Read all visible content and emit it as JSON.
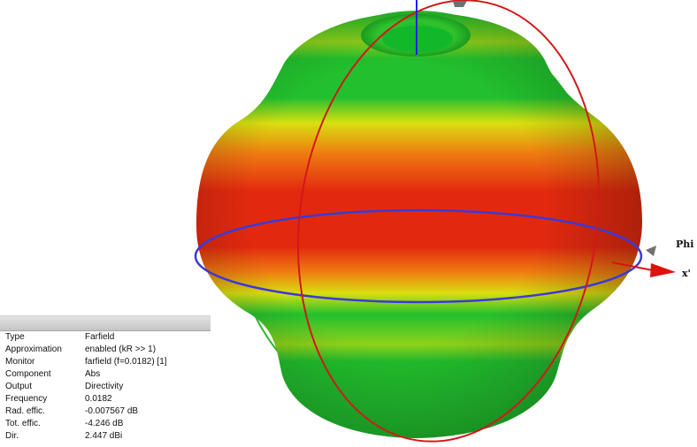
{
  "viewport": {
    "axis_labels": {
      "phi": "Phi",
      "x": "x'"
    },
    "colors": {
      "red": "#e2290f",
      "orange": "#ef7d10",
      "yellow": "#d9df10",
      "green": "#22c02e",
      "phi_circle": "#3a3ad8",
      "meridian_red": "#d21818",
      "meridian_green": "#2bb52b",
      "z_axis": "#2020ff",
      "x_arrow": "#e01010"
    }
  },
  "info": {
    "rows": [
      {
        "key": "Type",
        "value": "Farfield"
      },
      {
        "key": "Approximation",
        "value": "enabled (kR >> 1)"
      },
      {
        "key": "Monitor",
        "value": "farfield (f=0.0182) [1]"
      },
      {
        "key": "Component",
        "value": "Abs"
      },
      {
        "key": "Output",
        "value": "Directivity"
      },
      {
        "key": "Frequency",
        "value": "0.0182"
      },
      {
        "key": "Rad. effic.",
        "value": "-0.007567 dB"
      },
      {
        "key": "Tot. effic.",
        "value": "-4.246 dB"
      },
      {
        "key": "Dir.",
        "value": "2.447 dBi"
      }
    ]
  }
}
